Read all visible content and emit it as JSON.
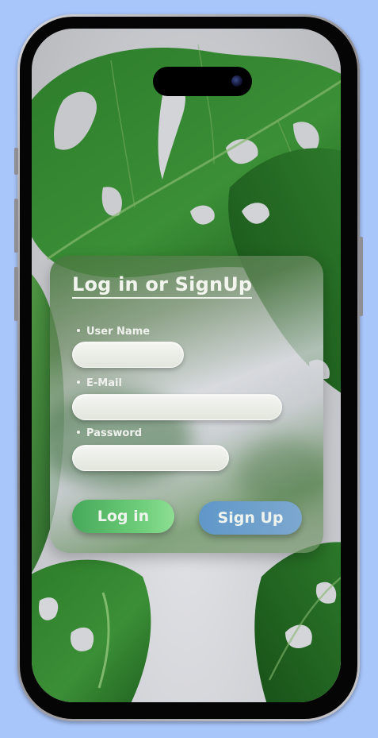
{
  "form": {
    "title": "Log in or SignUp",
    "fields": [
      {
        "label": "User Name",
        "value": "",
        "placeholder": ""
      },
      {
        "label": "E-Mail",
        "value": "",
        "placeholder": ""
      },
      {
        "label": "Password",
        "value": "",
        "placeholder": ""
      }
    ],
    "login_label": "Log in",
    "signup_label": "Sign Up"
  },
  "colors": {
    "page_background": "#a9c6fb",
    "login_button": "#5cbf6a",
    "signup_button": "#6f9fcc",
    "leaf_green": "#2f7a2e"
  },
  "icons": {
    "camera": "front-camera-icon",
    "bullet": "bullet-icon"
  }
}
